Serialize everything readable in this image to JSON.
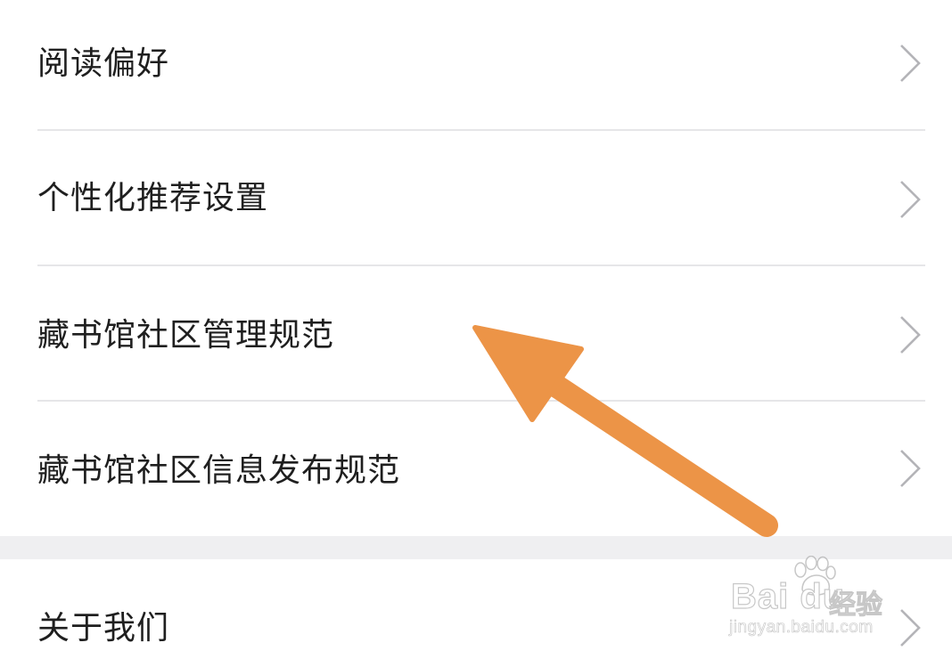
{
  "settings": {
    "items": [
      {
        "label": "阅读偏好",
        "chevron_icon": "chevron-right-icon"
      },
      {
        "label": "个性化推荐设置",
        "chevron_icon": "chevron-right-icon"
      },
      {
        "label": "藏书馆社区管理规范",
        "chevron_icon": "chevron-right-icon"
      },
      {
        "label": "藏书馆社区信息发布规范",
        "chevron_icon": "chevron-right-icon"
      }
    ],
    "secondary_items": [
      {
        "label": "关于我们",
        "chevron_icon": "chevron-right-icon"
      }
    ]
  },
  "annotation": {
    "type": "arrow",
    "color": "#ec9447",
    "points_to": "藏书馆社区管理规范"
  },
  "watermark": {
    "brand": "Bai du",
    "brand_suffix": "经验",
    "url": "jingyan.baidu.com"
  },
  "colors": {
    "text": "#1f1f1f",
    "chevron": "#b4b4b8",
    "divider": "#e6e6e8",
    "section_gap": "#efeff1",
    "background": "#ffffff"
  }
}
